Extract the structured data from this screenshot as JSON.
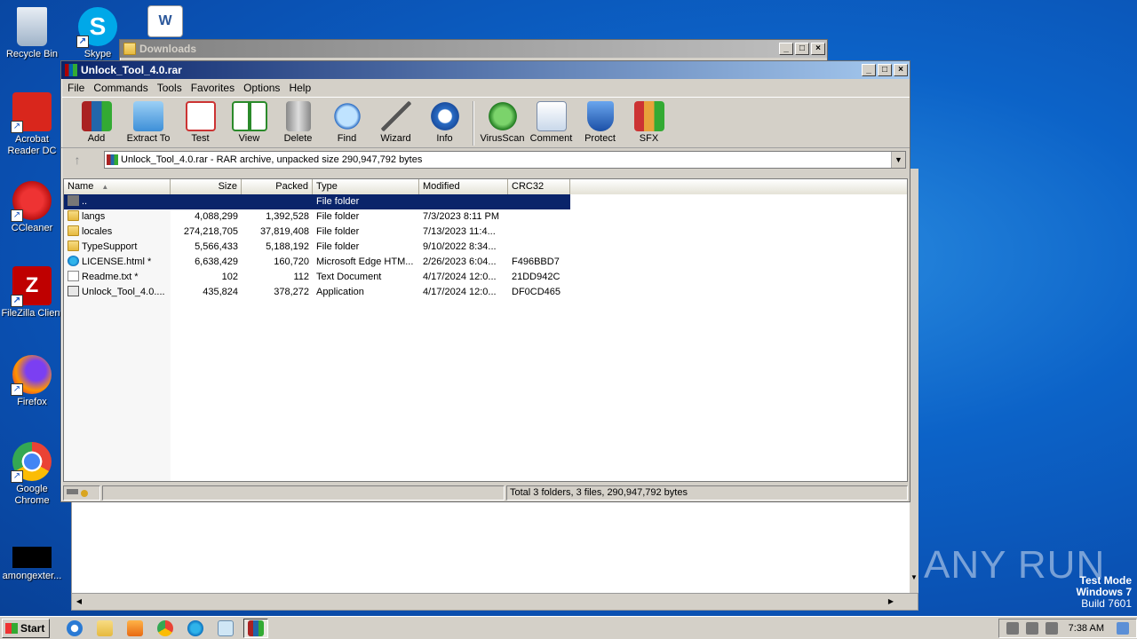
{
  "desktop": {
    "icons": [
      {
        "label": "Recycle Bin"
      },
      {
        "label": "Skype"
      },
      {
        "label": "Acrobat Reader DC"
      },
      {
        "label": "CCleaner"
      },
      {
        "label": "FileZilla Client"
      },
      {
        "label": "Firefox"
      },
      {
        "label": "Google Chrome"
      },
      {
        "label": "amongexter..."
      }
    ]
  },
  "bg_window": {
    "title": "Downloads"
  },
  "winrar": {
    "title": "Unlock_Tool_4.0.rar",
    "menu": [
      "File",
      "Commands",
      "Tools",
      "Favorites",
      "Options",
      "Help"
    ],
    "tools": [
      "Add",
      "Extract To",
      "Test",
      "View",
      "Delete",
      "Find",
      "Wizard",
      "Info",
      "VirusScan",
      "Comment",
      "Protect",
      "SFX"
    ],
    "address": "Unlock_Tool_4.0.rar - RAR archive, unpacked size 290,947,792 bytes",
    "columns": [
      "Name",
      "Size",
      "Packed",
      "Type",
      "Modified",
      "CRC32"
    ],
    "rows": [
      {
        "name": "..",
        "size": "",
        "packed": "",
        "type": "File folder",
        "modified": "",
        "crc": "",
        "icon": "parent"
      },
      {
        "name": "langs",
        "size": "4,088,299",
        "packed": "1,392,528",
        "type": "File folder",
        "modified": "7/3/2023 8:11 PM",
        "crc": "",
        "icon": "folder"
      },
      {
        "name": "locales",
        "size": "274,218,705",
        "packed": "37,819,408",
        "type": "File folder",
        "modified": "7/13/2023 11:4...",
        "crc": "",
        "icon": "folder"
      },
      {
        "name": "TypeSupport",
        "size": "5,566,433",
        "packed": "5,188,192",
        "type": "File folder",
        "modified": "9/10/2022 8:34...",
        "crc": "",
        "icon": "folder"
      },
      {
        "name": "LICENSE.html *",
        "size": "6,638,429",
        "packed": "160,720",
        "type": "Microsoft Edge HTM...",
        "modified": "2/26/2023 6:04...",
        "crc": "F496BBD7",
        "icon": "edge"
      },
      {
        "name": "Readme.txt *",
        "size": "102",
        "packed": "112",
        "type": "Text Document",
        "modified": "4/17/2024 12:0...",
        "crc": "21DD942C",
        "icon": "doc"
      },
      {
        "name": "Unlock_Tool_4.0....",
        "size": "435,824",
        "packed": "378,272",
        "type": "Application",
        "modified": "4/17/2024 12:0...",
        "crc": "DF0CD465",
        "icon": "app"
      }
    ],
    "status": "Total 3 folders, 3 files, 290,947,792 bytes"
  },
  "taskbar": {
    "start": "Start",
    "time": "7:38 AM"
  },
  "watermark": {
    "brand": "ANY RUN",
    "line1": "Test Mode",
    "line2": "Windows 7",
    "line3": "Build 7601"
  }
}
